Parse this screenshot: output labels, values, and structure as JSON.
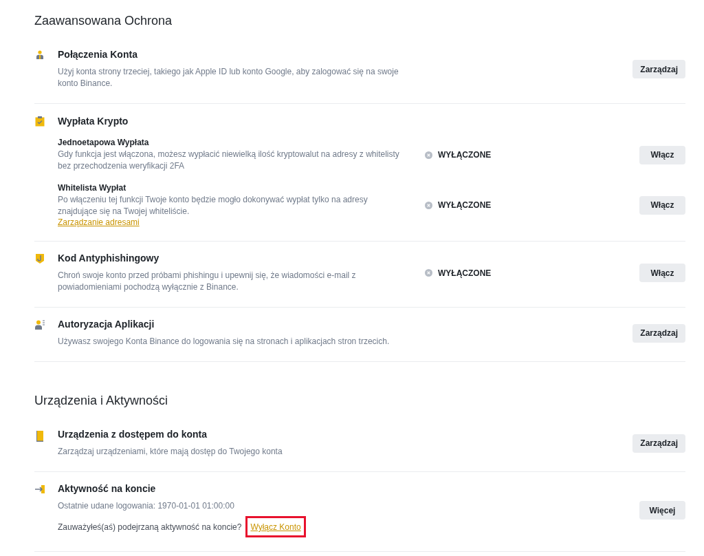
{
  "sections": [
    {
      "title": "Zaawansowana Ochrona",
      "items": [
        {
          "kind": "simple",
          "title": "Połączenia Konta",
          "description": "Użyj konta strony trzeciej, takiego jak Apple ID lub konto Google, aby zalogować się na swoje konto Binance.",
          "button": "Zarządzaj"
        },
        {
          "kind": "group",
          "title": "Wypłata Krypto",
          "subitems": [
            {
              "title": "Jednoetapowa Wypłata",
              "description": "Gdy funkcja jest włączona, możesz wypłacić niewielką ilość kryptowalut na adresy z whitelisty bez przechodzenia weryfikacji 2FA",
              "status": "WYŁĄCZONE",
              "enabled": false,
              "button": "Włącz"
            },
            {
              "title": "Whitelista Wypłat",
              "description": "Po włączeniu tej funkcji Twoje konto będzie mogło dokonywać wypłat tylko na adresy znajdujące się na Twojej whiteliście.",
              "link": "Zarządzanie adresami",
              "status": "WYŁĄCZONE",
              "enabled": false,
              "button": "Włącz"
            }
          ]
        },
        {
          "kind": "status",
          "title": "Kod Antyphishingowy",
          "description": "Chroń swoje konto przed próbami phishingu i upewnij się, że wiadomości e-mail z powiadomieniami pochodzą wyłącznie z Binance.",
          "status": "WYŁĄCZONE",
          "enabled": false,
          "button": "Włącz"
        },
        {
          "kind": "simple",
          "title": "Autoryzacja Aplikacji",
          "description": "Używasz swojego Konta Binance do logowania się na stronach i aplikacjach stron trzecich.",
          "button": "Zarządzaj"
        }
      ]
    },
    {
      "title": "Urządzenia i Aktywności",
      "items": [
        {
          "kind": "simple",
          "title": "Urządzenia z dostępem do konta",
          "description": "Zarządzaj urządzeniami, które mają dostęp do Twojego konta",
          "button": "Zarządzaj"
        },
        {
          "kind": "activity",
          "title": "Aktywność na koncie",
          "description": "Ostatnie udane logowania: 1970-01-01 01:00:00",
          "question": "Zauważyłeś(aś) podejrzaną aktywność na koncie?",
          "link": "Wyłącz Konto",
          "link_highlighted": true,
          "button": "Więcej"
        }
      ]
    }
  ]
}
